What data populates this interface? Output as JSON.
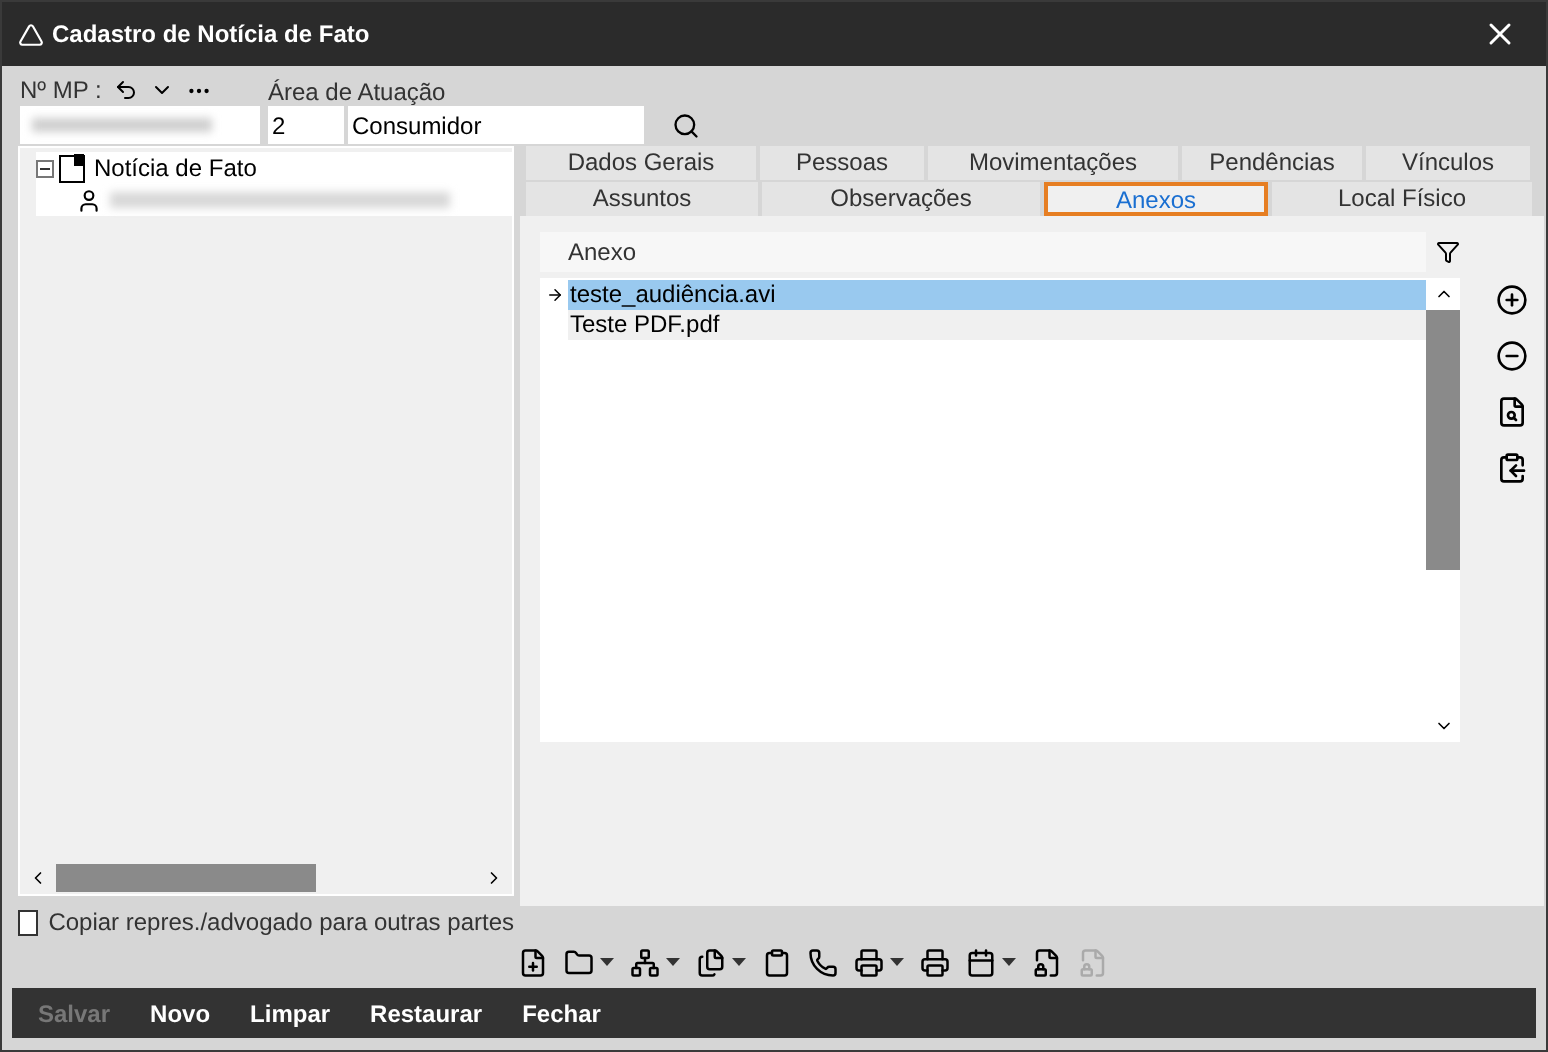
{
  "window": {
    "title": "Cadastro de Notícia de Fato"
  },
  "header": {
    "mp_label": "Nº MP :",
    "area_label": "Área de Atuação",
    "area_code": "2",
    "area_name": "Consumidor"
  },
  "tree": [
    {
      "label": "Notícia de Fato",
      "expanded": true,
      "children": [
        {
          "kind": "person"
        }
      ]
    }
  ],
  "copy_checkbox": {
    "label": "Copiar repres./advogado para outras partes",
    "checked": false
  },
  "tab_rows": [
    [
      {
        "label": "Dados Gerais",
        "selected": false
      },
      {
        "label": "Pessoas",
        "selected": false
      },
      {
        "label": "Movimentações",
        "selected": false
      },
      {
        "label": "Pendências",
        "selected": false
      },
      {
        "label": "Vínculos",
        "selected": false
      }
    ],
    [
      {
        "label": "Assuntos",
        "selected": false
      },
      {
        "label": "Observações",
        "selected": false
      },
      {
        "label": "Anexos",
        "selected": true
      },
      {
        "label": "Local Físico",
        "selected": false
      }
    ]
  ],
  "grid": {
    "column": "Anexo",
    "rows": [
      {
        "name": "teste_audiência.avi",
        "selected": true
      },
      {
        "name": "Teste PDF.pdf",
        "selected": false
      }
    ]
  },
  "footer_buttons": [
    {
      "label": "Salvar",
      "disabled": true
    },
    {
      "label": "Novo",
      "disabled": false
    },
    {
      "label": "Limpar",
      "disabled": false
    },
    {
      "label": "Restaurar",
      "disabled": false
    },
    {
      "label": "Fechar",
      "disabled": false
    }
  ]
}
